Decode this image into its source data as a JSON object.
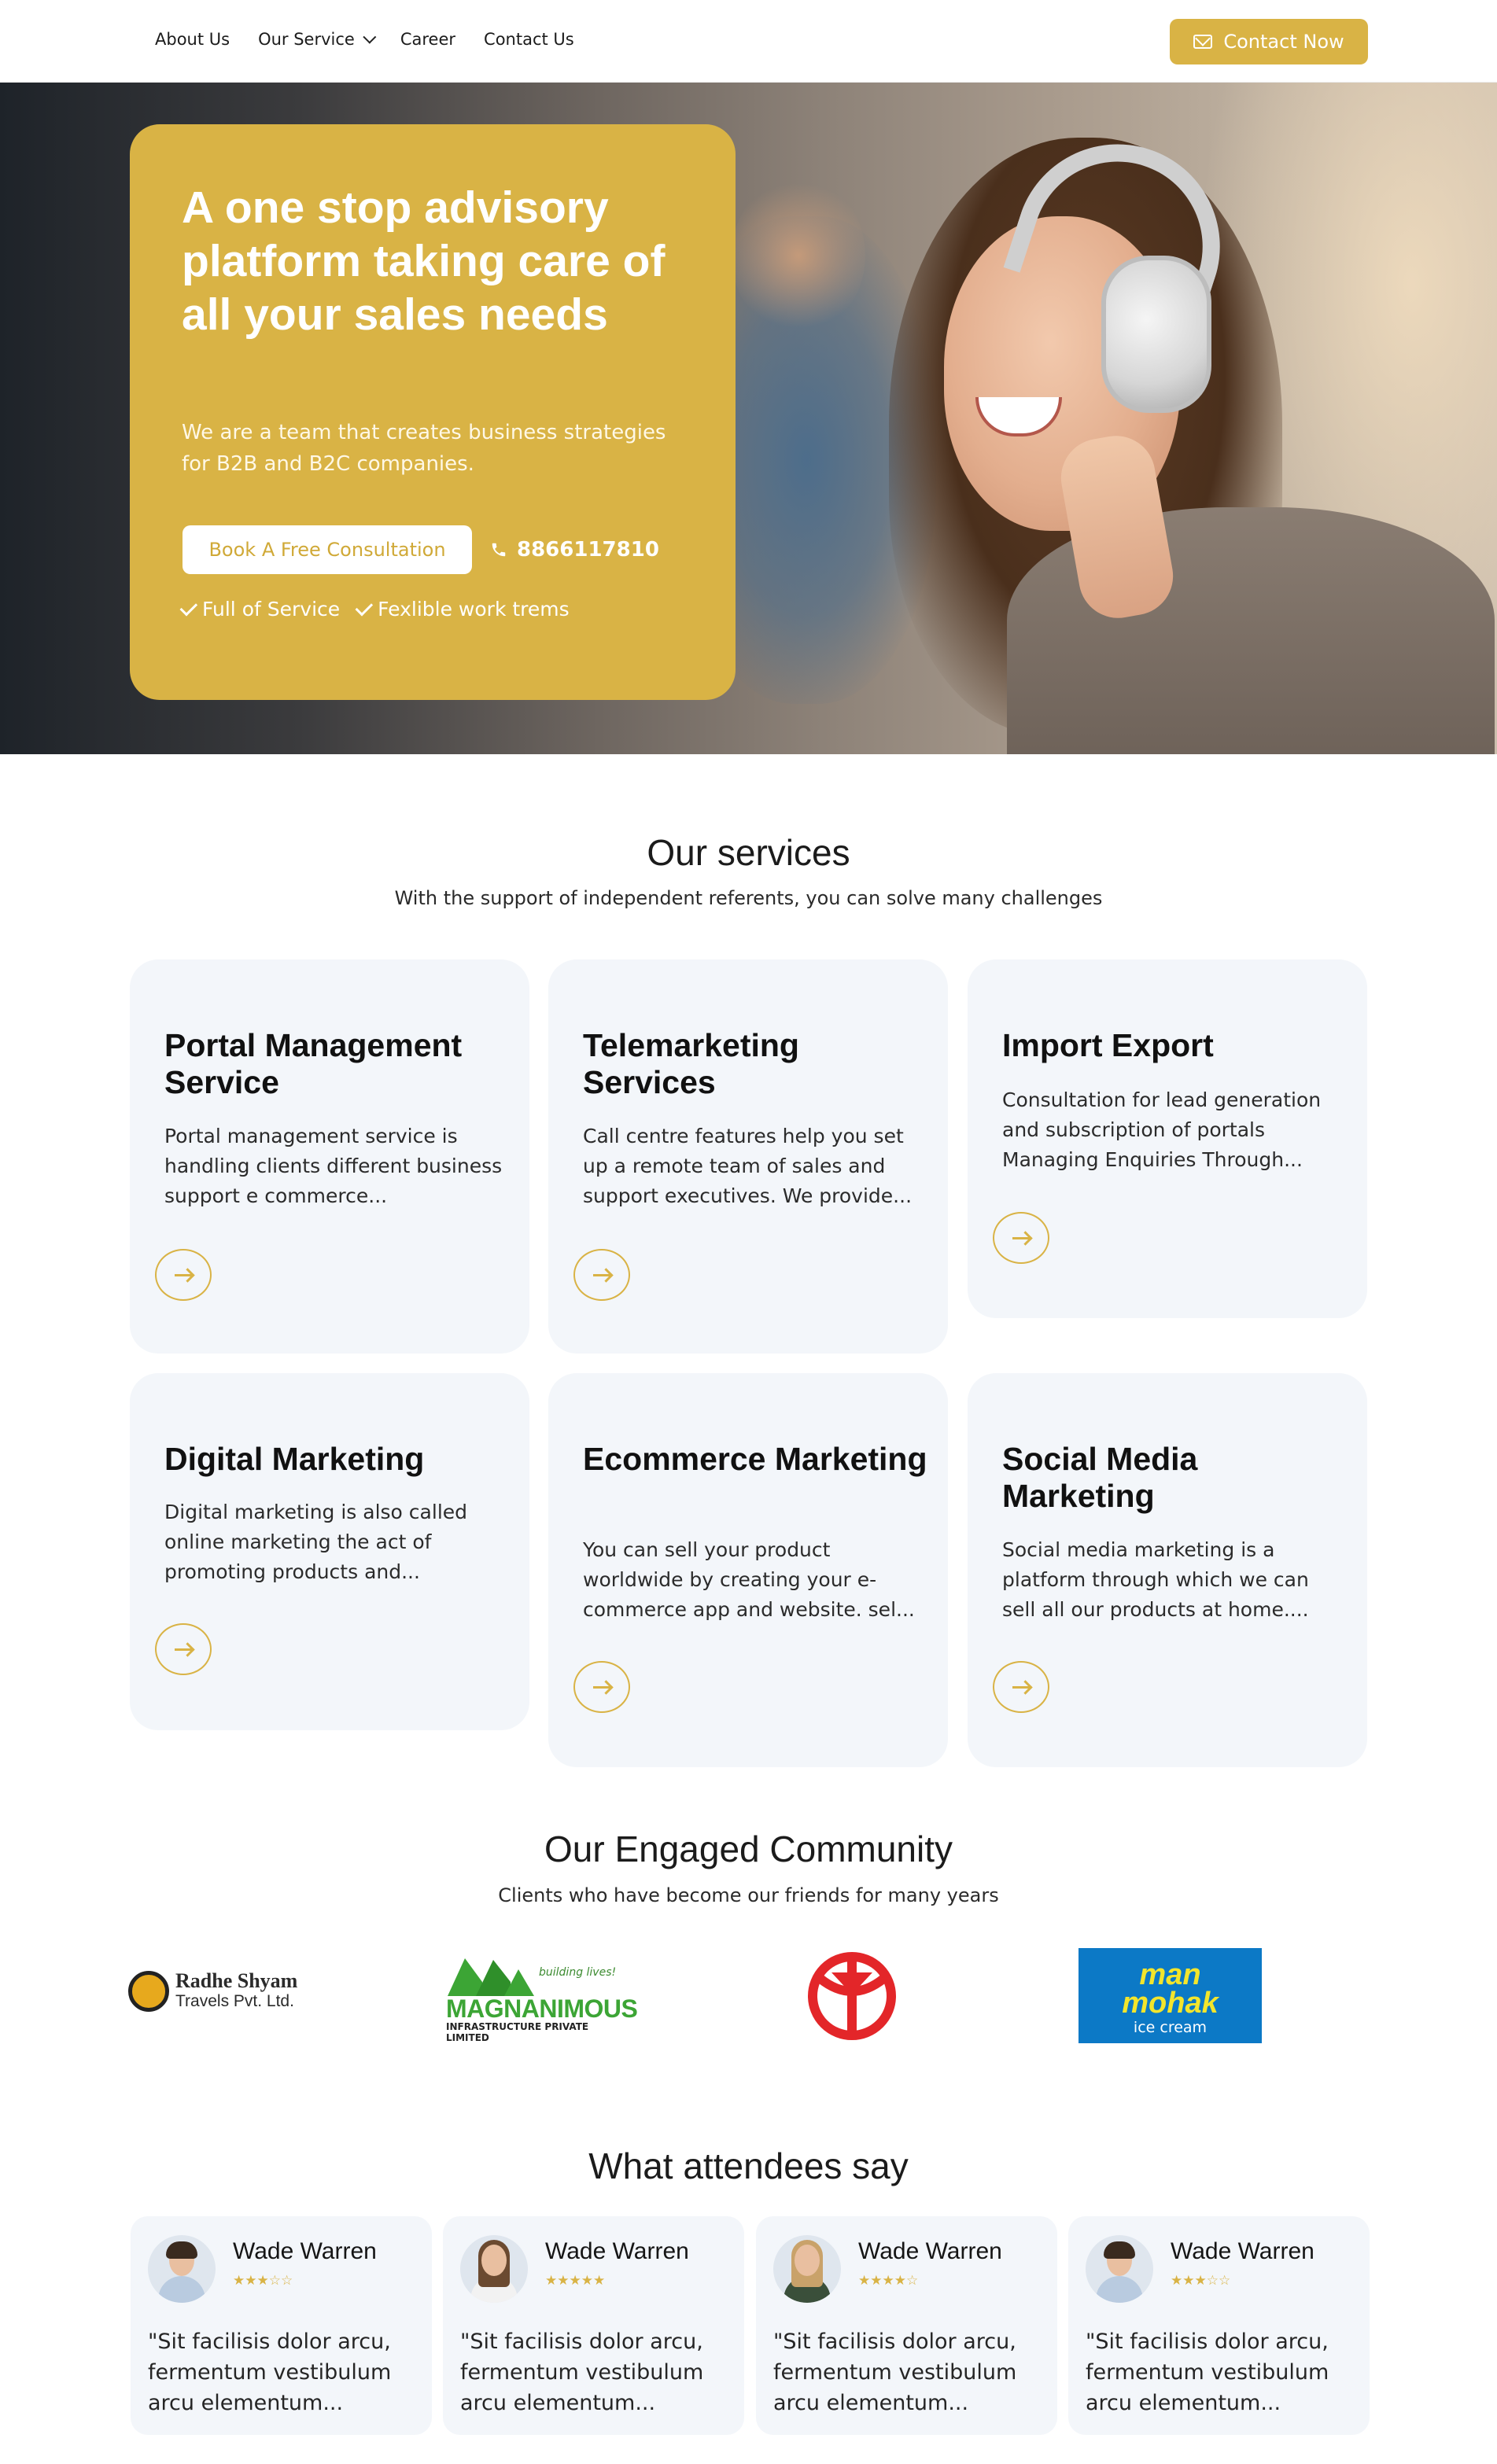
{
  "nav": {
    "links": [
      {
        "label": "About Us"
      },
      {
        "label": "Our Service"
      },
      {
        "label": "Career"
      },
      {
        "label": "Contact Us"
      }
    ],
    "cta_label": "Contact Now"
  },
  "hero": {
    "title": "A one stop advisory platform taking care of all your sales needs",
    "subtitle": "We are a team that creates business strategies for B2B and B2C companies.",
    "button_label": "Book A Free Consultation",
    "phone": "8866117810",
    "checks": [
      "Full of Service",
      "Fexlible work trems"
    ]
  },
  "services": {
    "title": "Our services",
    "subtitle": "With the support of independent referents, you can solve many challenges",
    "cards": [
      {
        "title": "Portal Management Service",
        "desc": "Portal management service is handling clients different business support e commerce..."
      },
      {
        "title": "Telemarketing Services",
        "desc": "Call centre features help you set up a remote team of sales and support executives. We provide..."
      },
      {
        "title": "Import Export",
        "desc": "Consultation for lead generation and subscription of portals Managing Enquiries Through..."
      },
      {
        "title": "Digital Marketing",
        "desc": "Digital marketing is also called online marketing the act of promoting products and..."
      },
      {
        "title": "Ecommerce Marketing",
        "desc": "You can sell your product worldwide by creating your e-commerce app and website. sel..."
      },
      {
        "title": "Social Media Marketing",
        "desc": "Social media marketing is a platform through which we can sell all our products at home...."
      }
    ]
  },
  "community": {
    "title": "Our Engaged Community",
    "subtitle": "Clients who have become our friends for many years",
    "logos": {
      "radhe_name": "Radhe Shyam",
      "radhe_sub": "Travels Pvt. Ltd.",
      "mag_tag": "building lives!",
      "mag_name": "MAGNANIMOUS",
      "mag_sub": "INFRASTRUCTURE PRIVATE LIMITED",
      "man_line1": "man",
      "man_line2": "mohak",
      "man_sub": "ice cream"
    }
  },
  "testimonials": {
    "title": "What attendees say",
    "items": [
      {
        "name": "Wade Warren",
        "stars": "★★★☆☆",
        "quote": "\"Sit facilisis dolor arcu, fermentum vestibulum arcu elementum..."
      },
      {
        "name": "Wade Warren",
        "stars": "★★★★★",
        "quote": "\"Sit facilisis dolor arcu, fermentum vestibulum arcu elementum..."
      },
      {
        "name": "Wade Warren",
        "stars": "★★★★☆",
        "quote": "\"Sit facilisis dolor arcu, fermentum vestibulum arcu elementum..."
      },
      {
        "name": "Wade Warren",
        "stars": "★★★☆☆",
        "quote": "\"Sit facilisis dolor arcu, fermentum vestibulum arcu elementum..."
      }
    ]
  },
  "colors": {
    "accent": "#d9b345",
    "card_bg": "#f3f6fa"
  }
}
